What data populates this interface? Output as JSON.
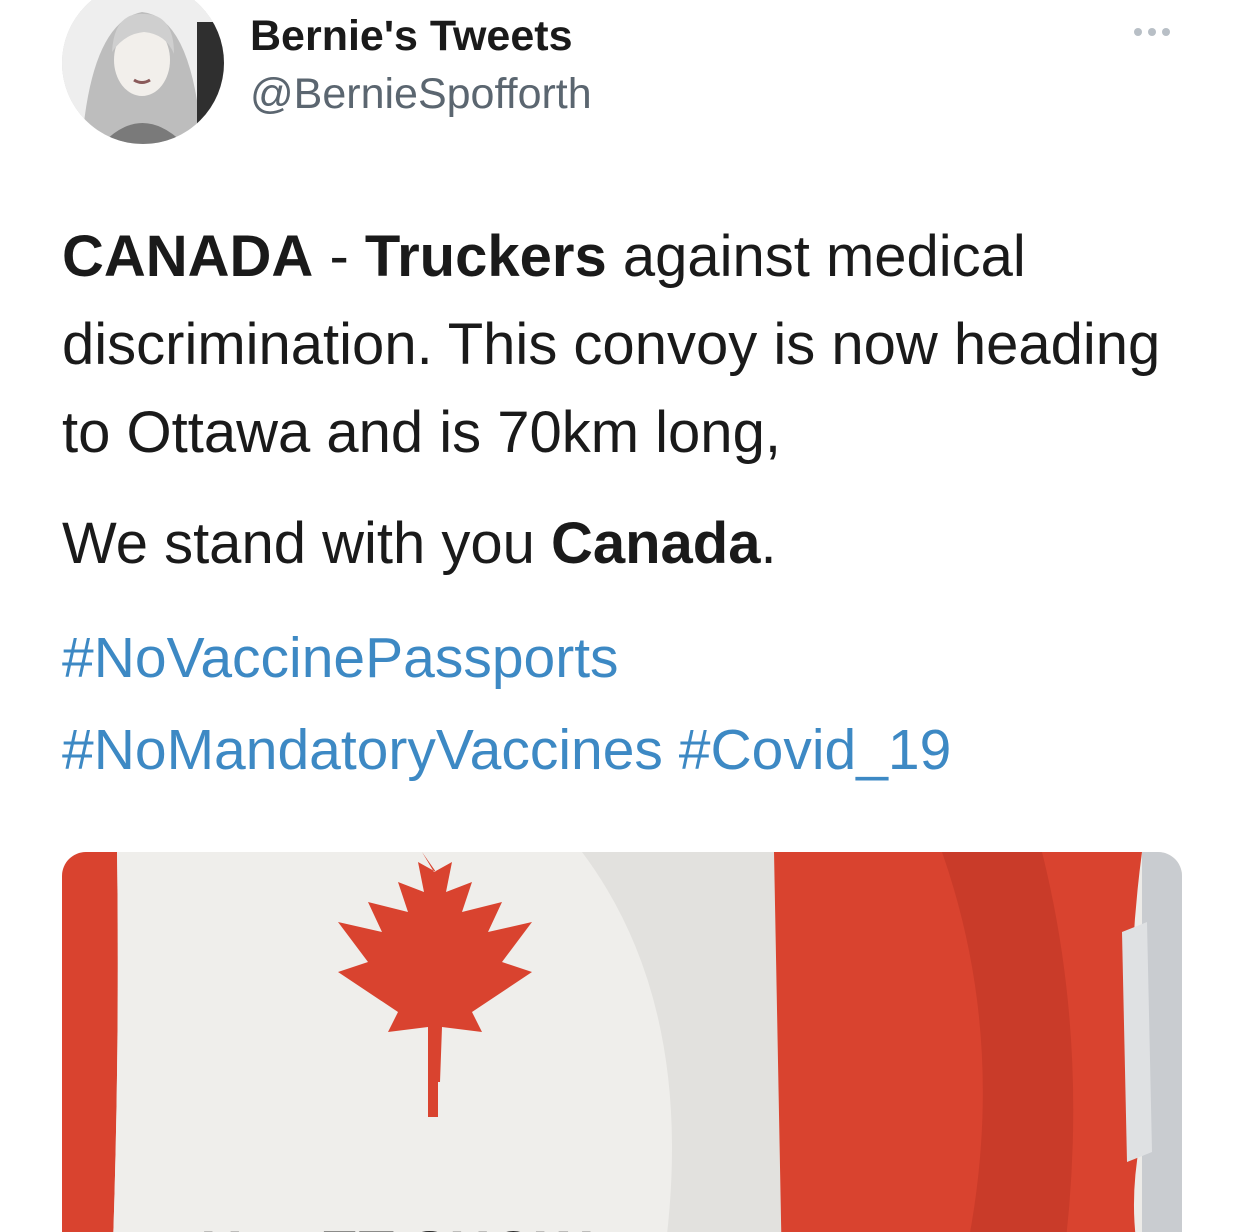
{
  "tweet": {
    "display_name": "Bernie's Tweets",
    "handle": "@BernieSpofforth",
    "avatar_icon": "profile-photo",
    "more_icon": "more-dots-icon",
    "body": {
      "line1": {
        "part1_bold": "CANADA",
        "part2": " - ",
        "part3_bold": "Truckers",
        "part4": " against medical discrimination. This convoy is now heading to Ottawa and is 70km long,"
      },
      "line2": {
        "part1": "We stand with you ",
        "part2_bold": "Canada",
        "part3": "."
      }
    },
    "hashtags": {
      "tag1": "#NoVaccinePassports",
      "tag2": "#NoMandatoryVaccines",
      "tag3": "#Covid_19"
    },
    "media": {
      "caption_partial": "PUPPET SHOW",
      "colors": {
        "red": "#d9432f",
        "white": "#ecebe8",
        "link": "#3d89c4"
      }
    }
  }
}
